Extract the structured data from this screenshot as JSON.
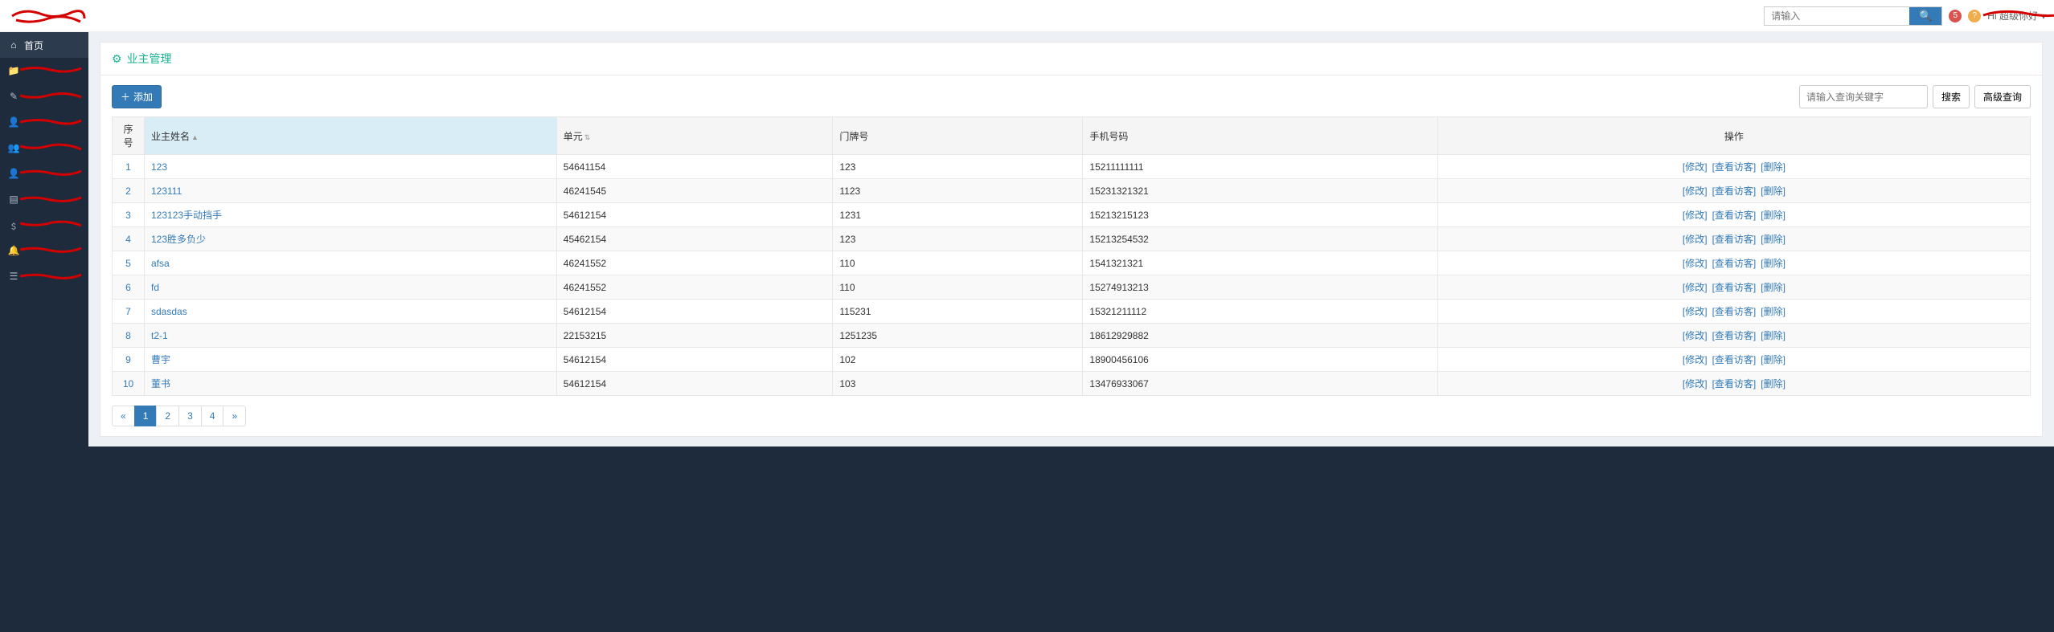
{
  "top": {
    "search_placeholder": "请输入",
    "badge_red": "5",
    "badge_orange": "?",
    "user_label": "Hi    超级你好",
    "caret": "▾"
  },
  "sidebar": {
    "items": [
      {
        "icon": "home",
        "label": "首页"
      },
      {
        "icon": "folder",
        "label": ""
      },
      {
        "icon": "edit",
        "label": ""
      },
      {
        "icon": "user",
        "label": ""
      },
      {
        "icon": "users",
        "label": ""
      },
      {
        "icon": "user",
        "label": ""
      },
      {
        "icon": "list",
        "label": ""
      },
      {
        "icon": "money",
        "label": ""
      },
      {
        "icon": "bell",
        "label": ""
      },
      {
        "icon": "bars",
        "label": ""
      }
    ]
  },
  "panel": {
    "title": "业主管理",
    "add_label": "添加",
    "search_placeholder": "请输入查询关键字",
    "search_btn": "搜索",
    "adv_search_btn": "高级查询"
  },
  "table": {
    "headers": {
      "idx": "序号",
      "name": "业主姓名",
      "unit": "单元",
      "door": "门牌号",
      "phone": "手机号码",
      "ops": "操作"
    },
    "op_labels": {
      "edit": "[修改]",
      "view": "[查看访客]",
      "del": "[删除]"
    },
    "rows": [
      {
        "idx": 1,
        "name": "123",
        "unit": "54641154",
        "door": "123",
        "phone": "15211111111"
      },
      {
        "idx": 2,
        "name": "123111",
        "unit": "46241545",
        "door": "1123",
        "phone": "15231321321"
      },
      {
        "idx": 3,
        "name": "123123手动挡手",
        "unit": "54612154",
        "door": "1231",
        "phone": "15213215123"
      },
      {
        "idx": 4,
        "name": "123胜多负少",
        "unit": "45462154",
        "door": "123",
        "phone": "15213254532"
      },
      {
        "idx": 5,
        "name": "afsa",
        "unit": "46241552",
        "door": "110",
        "phone": "1541321321"
      },
      {
        "idx": 6,
        "name": "fd",
        "unit": "46241552",
        "door": "110",
        "phone": "15274913213"
      },
      {
        "idx": 7,
        "name": "sdasdas",
        "unit": "54612154",
        "door": "115231",
        "phone": "15321211112"
      },
      {
        "idx": 8,
        "name": "t2-1",
        "unit": "22153215",
        "door": "1251235",
        "phone": "18612929882"
      },
      {
        "idx": 9,
        "name": "曹宇",
        "unit": "54612154",
        "door": "102",
        "phone": "18900456106"
      },
      {
        "idx": 10,
        "name": "董书",
        "unit": "54612154",
        "door": "103",
        "phone": "13476933067"
      }
    ]
  },
  "pagination": {
    "prev": "«",
    "pages": [
      "1",
      "2",
      "3",
      "4"
    ],
    "next": "»",
    "active": 1
  }
}
